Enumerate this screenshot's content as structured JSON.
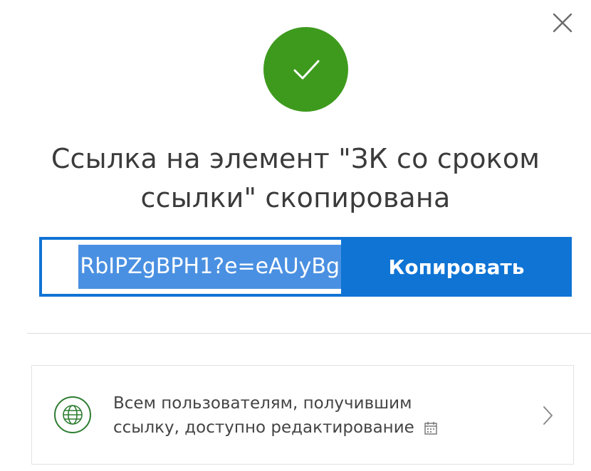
{
  "dialog": {
    "close_icon": "close-icon",
    "success_icon": "checkmark-icon",
    "success_color": "#3e9a1d",
    "title_line1": "Ссылка на элемент \"ЗК со сроком",
    "title_line2": "ссылки\" скопирована"
  },
  "link": {
    "visible_value": "RbIPZgBPH1?e=eAUyBg",
    "copy_label": "Копировать",
    "accent_color": "#0f74d4"
  },
  "permission": {
    "icon": "globe-icon",
    "line1": "Всем пользователям, получившим",
    "line2": "ссылку, доступно редактирование",
    "calendar_icon": "calendar-icon",
    "chevron_icon": "chevron-right-icon"
  }
}
